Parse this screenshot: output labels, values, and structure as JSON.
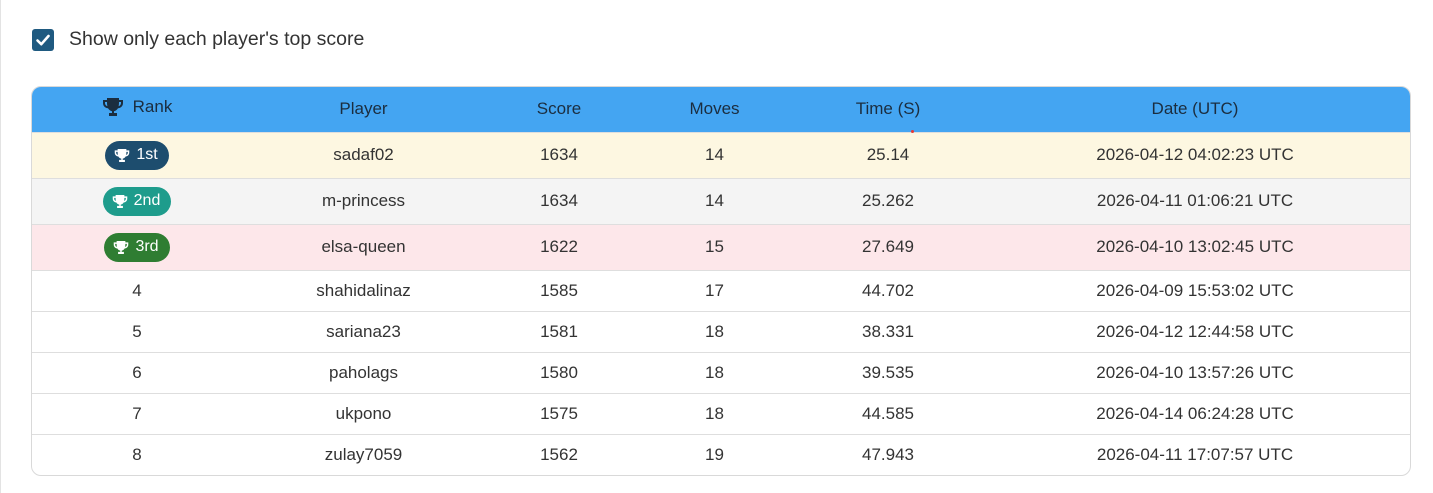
{
  "filter": {
    "checked": true,
    "label": "Show only each player's top score"
  },
  "table": {
    "headers": {
      "rank": "Rank",
      "player": "Player",
      "score": "Score",
      "moves": "Moves",
      "time": "Time (S)",
      "date": "Date (UTC)"
    },
    "rows": [
      {
        "rank": "1st",
        "player": "sadaf02",
        "score": "1634",
        "moves": "14",
        "time": "25.14",
        "date": "2026-04-12 04:02:23 UTC"
      },
      {
        "rank": "2nd",
        "player": "m-princess",
        "score": "1634",
        "moves": "14",
        "time": "25.262",
        "date": "2026-04-11 01:06:21 UTC"
      },
      {
        "rank": "3rd",
        "player": "elsa-queen",
        "score": "1622",
        "moves": "15",
        "time": "27.649",
        "date": "2026-04-10 13:02:45 UTC"
      },
      {
        "rank": "4",
        "player": "shahidalinaz",
        "score": "1585",
        "moves": "17",
        "time": "44.702",
        "date": "2026-04-09 15:53:02 UTC"
      },
      {
        "rank": "5",
        "player": "sariana23",
        "score": "1581",
        "moves": "18",
        "time": "38.331",
        "date": "2026-04-12 12:44:58 UTC"
      },
      {
        "rank": "6",
        "player": "paholags",
        "score": "1580",
        "moves": "18",
        "time": "39.535",
        "date": "2026-04-10 13:57:26 UTC"
      },
      {
        "rank": "7",
        "player": "ukpono",
        "score": "1575",
        "moves": "18",
        "time": "44.585",
        "date": "2026-04-14 06:24:28 UTC"
      },
      {
        "rank": "8",
        "player": "zulay7059",
        "score": "1562",
        "moves": "19",
        "time": "47.943",
        "date": "2026-04-11 17:07:57 UTC"
      }
    ]
  },
  "colors": {
    "header_bg": "#44a5f2",
    "gold_row": "#fdf7e1",
    "silver_row": "#f4f4f4",
    "bronze_row": "#fde7ea",
    "badge_1st": "#1d4d6e",
    "badge_2nd": "#1e9c8c",
    "badge_3rd": "#2f7d32",
    "checkbox": "#1f5a80"
  },
  "icons": {
    "checkbox": "checkmark-icon",
    "rank_header": "trophy-icon",
    "badge": "trophy-icon"
  }
}
